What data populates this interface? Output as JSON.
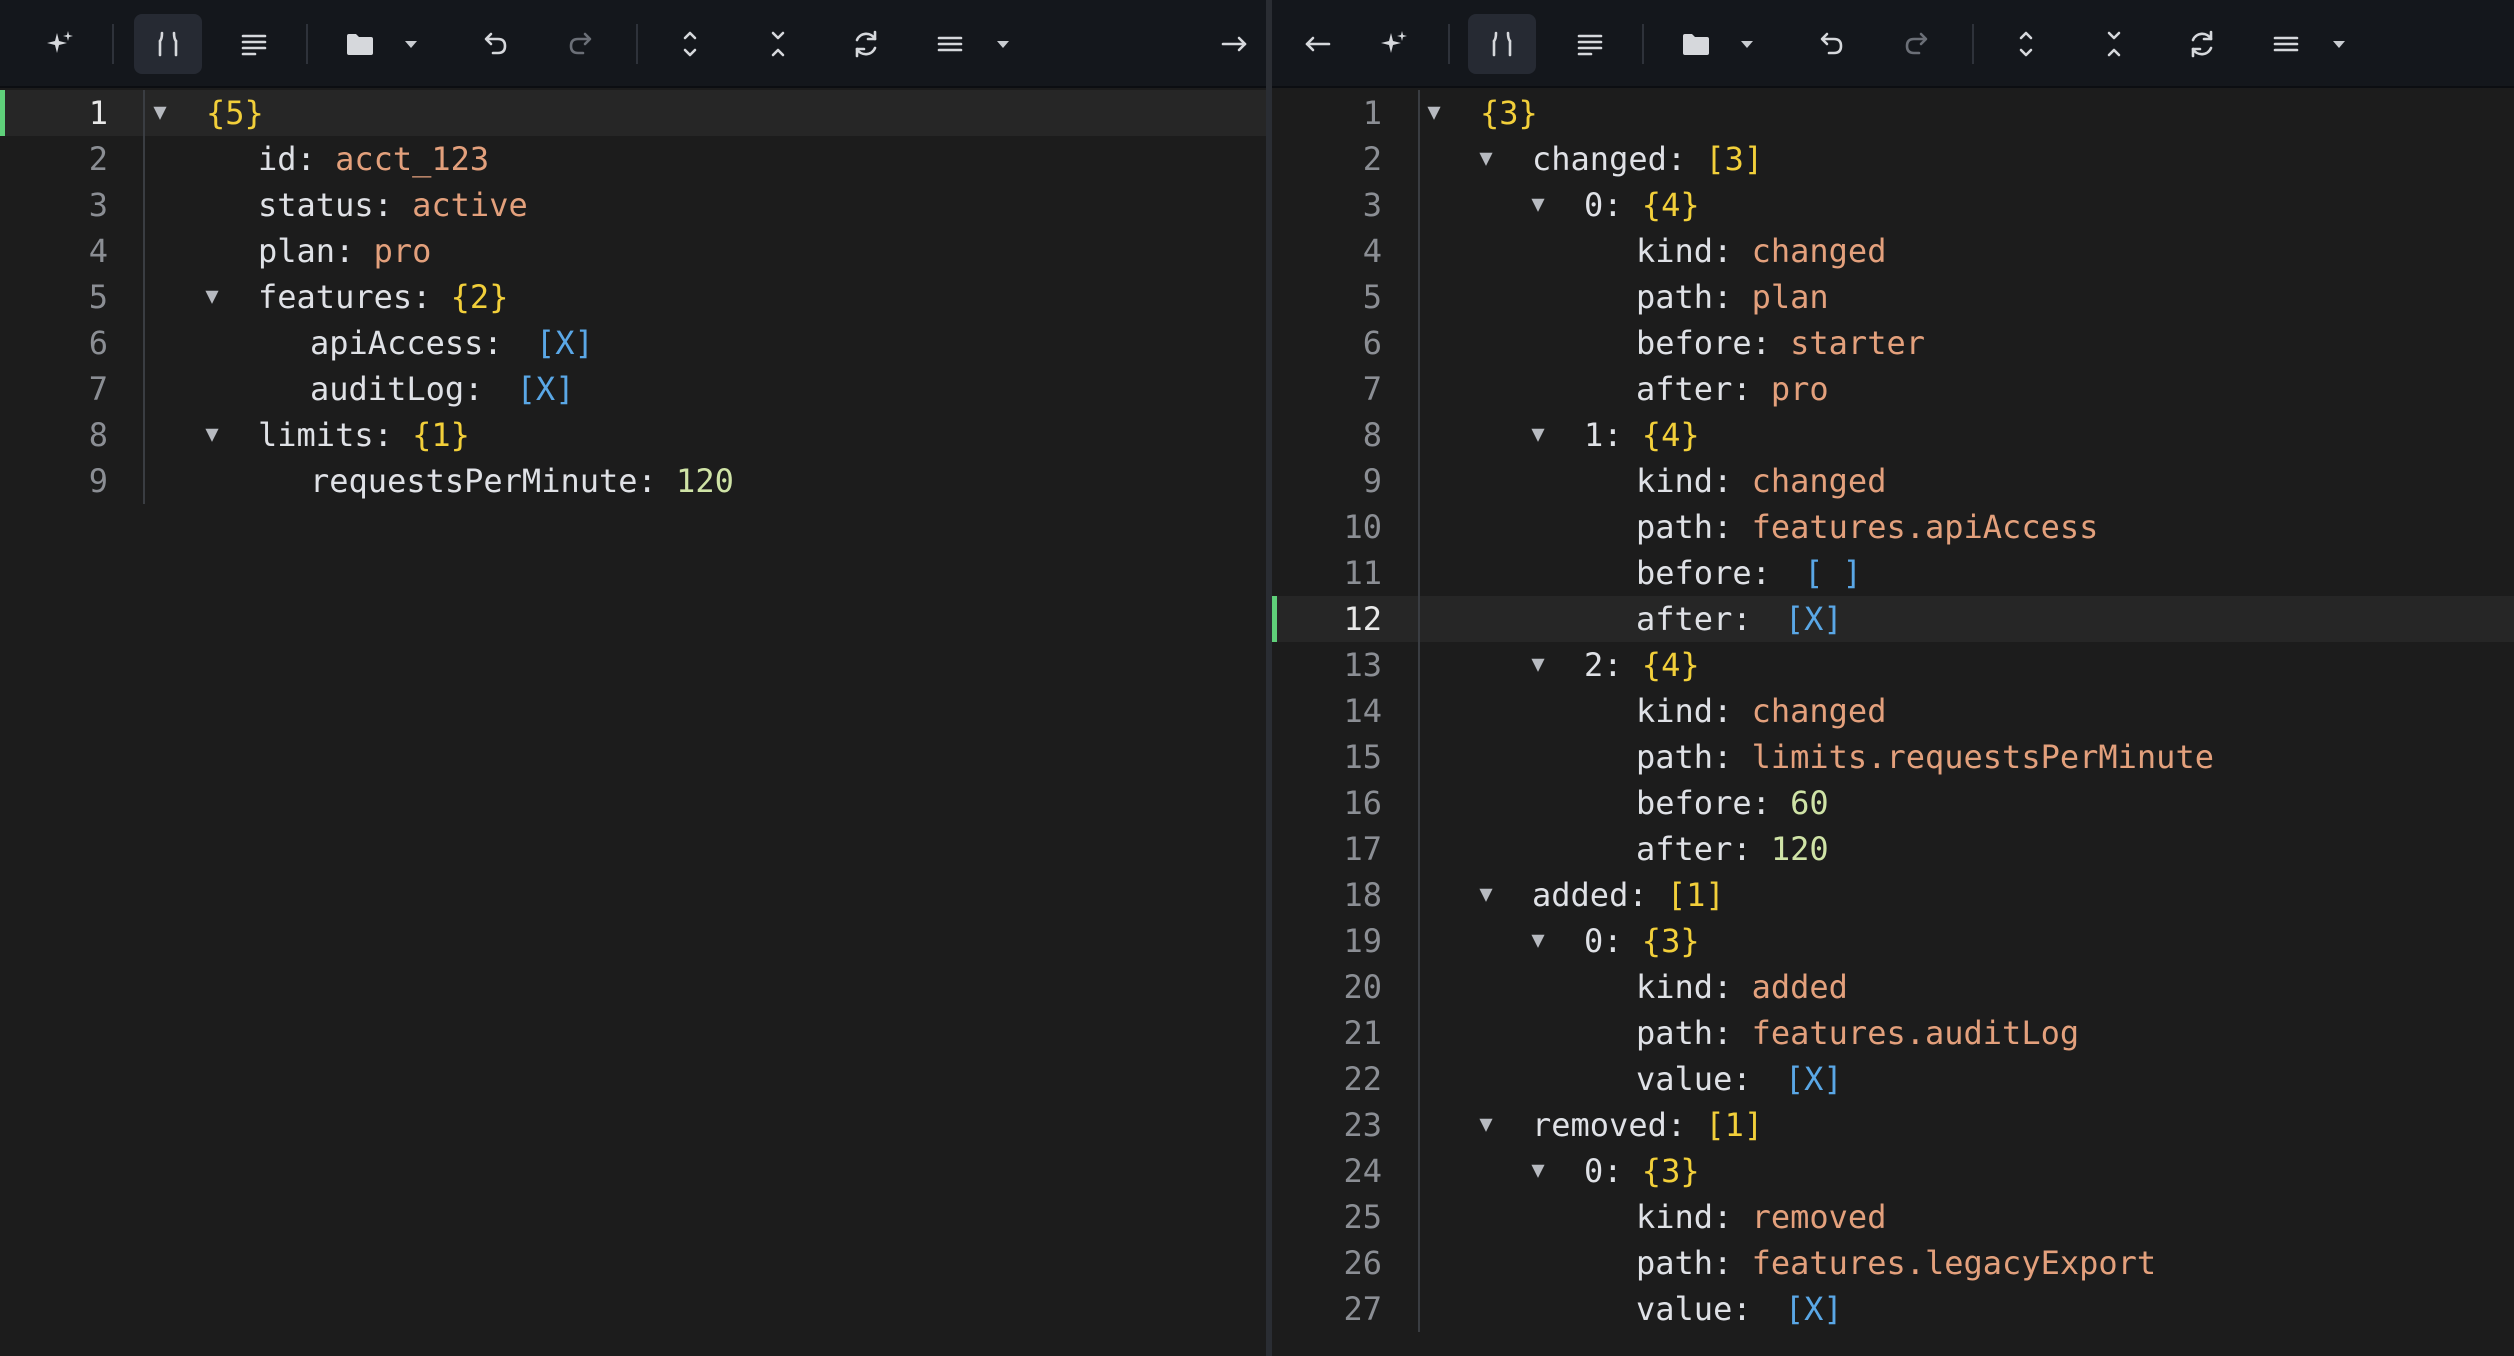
{
  "left_pane": {
    "lines": [
      {
        "n": "1",
        "indent": 0,
        "fold": true,
        "key": "",
        "value": "{5}",
        "vtype": "count",
        "active": true
      },
      {
        "n": "2",
        "indent": 1,
        "fold": false,
        "key": "id",
        "value": "acct_123",
        "vtype": "str"
      },
      {
        "n": "3",
        "indent": 1,
        "fold": false,
        "key": "status",
        "value": "active",
        "vtype": "str"
      },
      {
        "n": "4",
        "indent": 1,
        "fold": false,
        "key": "plan",
        "value": "pro",
        "vtype": "str"
      },
      {
        "n": "5",
        "indent": 1,
        "fold": true,
        "key": "features",
        "value": "{2}",
        "vtype": "count"
      },
      {
        "n": "6",
        "indent": 2,
        "fold": false,
        "key": "apiAccess",
        "value": "[X]",
        "vtype": "bool"
      },
      {
        "n": "7",
        "indent": 2,
        "fold": false,
        "key": "auditLog",
        "value": "[X]",
        "vtype": "bool"
      },
      {
        "n": "8",
        "indent": 1,
        "fold": true,
        "key": "limits",
        "value": "{1}",
        "vtype": "count"
      },
      {
        "n": "9",
        "indent": 2,
        "fold": false,
        "key": "requestsPerMinute",
        "value": "120",
        "vtype": "num"
      }
    ]
  },
  "right_pane": {
    "lines": [
      {
        "n": "1",
        "indent": 0,
        "fold": true,
        "key": "",
        "value": "{3}",
        "vtype": "count"
      },
      {
        "n": "2",
        "indent": 1,
        "fold": true,
        "key": "changed",
        "value": "[3]",
        "vtype": "count"
      },
      {
        "n": "3",
        "indent": 2,
        "fold": true,
        "key": "0",
        "value": "{4}",
        "vtype": "count"
      },
      {
        "n": "4",
        "indent": 3,
        "fold": false,
        "key": "kind",
        "value": "changed",
        "vtype": "str"
      },
      {
        "n": "5",
        "indent": 3,
        "fold": false,
        "key": "path",
        "value": "plan",
        "vtype": "str"
      },
      {
        "n": "6",
        "indent": 3,
        "fold": false,
        "key": "before",
        "value": "starter",
        "vtype": "str"
      },
      {
        "n": "7",
        "indent": 3,
        "fold": false,
        "key": "after",
        "value": "pro",
        "vtype": "str"
      },
      {
        "n": "8",
        "indent": 2,
        "fold": true,
        "key": "1",
        "value": "{4}",
        "vtype": "count"
      },
      {
        "n": "9",
        "indent": 3,
        "fold": false,
        "key": "kind",
        "value": "changed",
        "vtype": "str"
      },
      {
        "n": "10",
        "indent": 3,
        "fold": false,
        "key": "path",
        "value": "features.apiAccess",
        "vtype": "str"
      },
      {
        "n": "11",
        "indent": 3,
        "fold": false,
        "key": "before",
        "value": "[ ]",
        "vtype": "bool"
      },
      {
        "n": "12",
        "indent": 3,
        "fold": false,
        "key": "after",
        "value": "[X]",
        "vtype": "bool",
        "active": true
      },
      {
        "n": "13",
        "indent": 2,
        "fold": true,
        "key": "2",
        "value": "{4}",
        "vtype": "count"
      },
      {
        "n": "14",
        "indent": 3,
        "fold": false,
        "key": "kind",
        "value": "changed",
        "vtype": "str"
      },
      {
        "n": "15",
        "indent": 3,
        "fold": false,
        "key": "path",
        "value": "limits.requestsPerMinute",
        "vtype": "str"
      },
      {
        "n": "16",
        "indent": 3,
        "fold": false,
        "key": "before",
        "value": "60",
        "vtype": "num"
      },
      {
        "n": "17",
        "indent": 3,
        "fold": false,
        "key": "after",
        "value": "120",
        "vtype": "num"
      },
      {
        "n": "18",
        "indent": 1,
        "fold": true,
        "key": "added",
        "value": "[1]",
        "vtype": "count"
      },
      {
        "n": "19",
        "indent": 2,
        "fold": true,
        "key": "0",
        "value": "{3}",
        "vtype": "count"
      },
      {
        "n": "20",
        "indent": 3,
        "fold": false,
        "key": "kind",
        "value": "added",
        "vtype": "str"
      },
      {
        "n": "21",
        "indent": 3,
        "fold": false,
        "key": "path",
        "value": "features.auditLog",
        "vtype": "str"
      },
      {
        "n": "22",
        "indent": 3,
        "fold": false,
        "key": "value",
        "value": "[X]",
        "vtype": "bool"
      },
      {
        "n": "23",
        "indent": 1,
        "fold": true,
        "key": "removed",
        "value": "[1]",
        "vtype": "count"
      },
      {
        "n": "24",
        "indent": 2,
        "fold": true,
        "key": "0",
        "value": "{3}",
        "vtype": "count"
      },
      {
        "n": "25",
        "indent": 3,
        "fold": false,
        "key": "kind",
        "value": "removed",
        "vtype": "str"
      },
      {
        "n": "26",
        "indent": 3,
        "fold": false,
        "key": "path",
        "value": "features.legacyExport",
        "vtype": "str"
      },
      {
        "n": "27",
        "indent": 3,
        "fold": false,
        "key": "value",
        "value": "[X]",
        "vtype": "bool"
      }
    ]
  },
  "colors": {
    "background": "#1c1c1c",
    "toolbar": "#14171c",
    "key": "#dfe1e6",
    "string": "#e3a07c",
    "number": "#cfe3a6",
    "boolean": "#5aa7e6",
    "count": "#f2cf3a",
    "active_line_marker": "#5fd07a"
  }
}
